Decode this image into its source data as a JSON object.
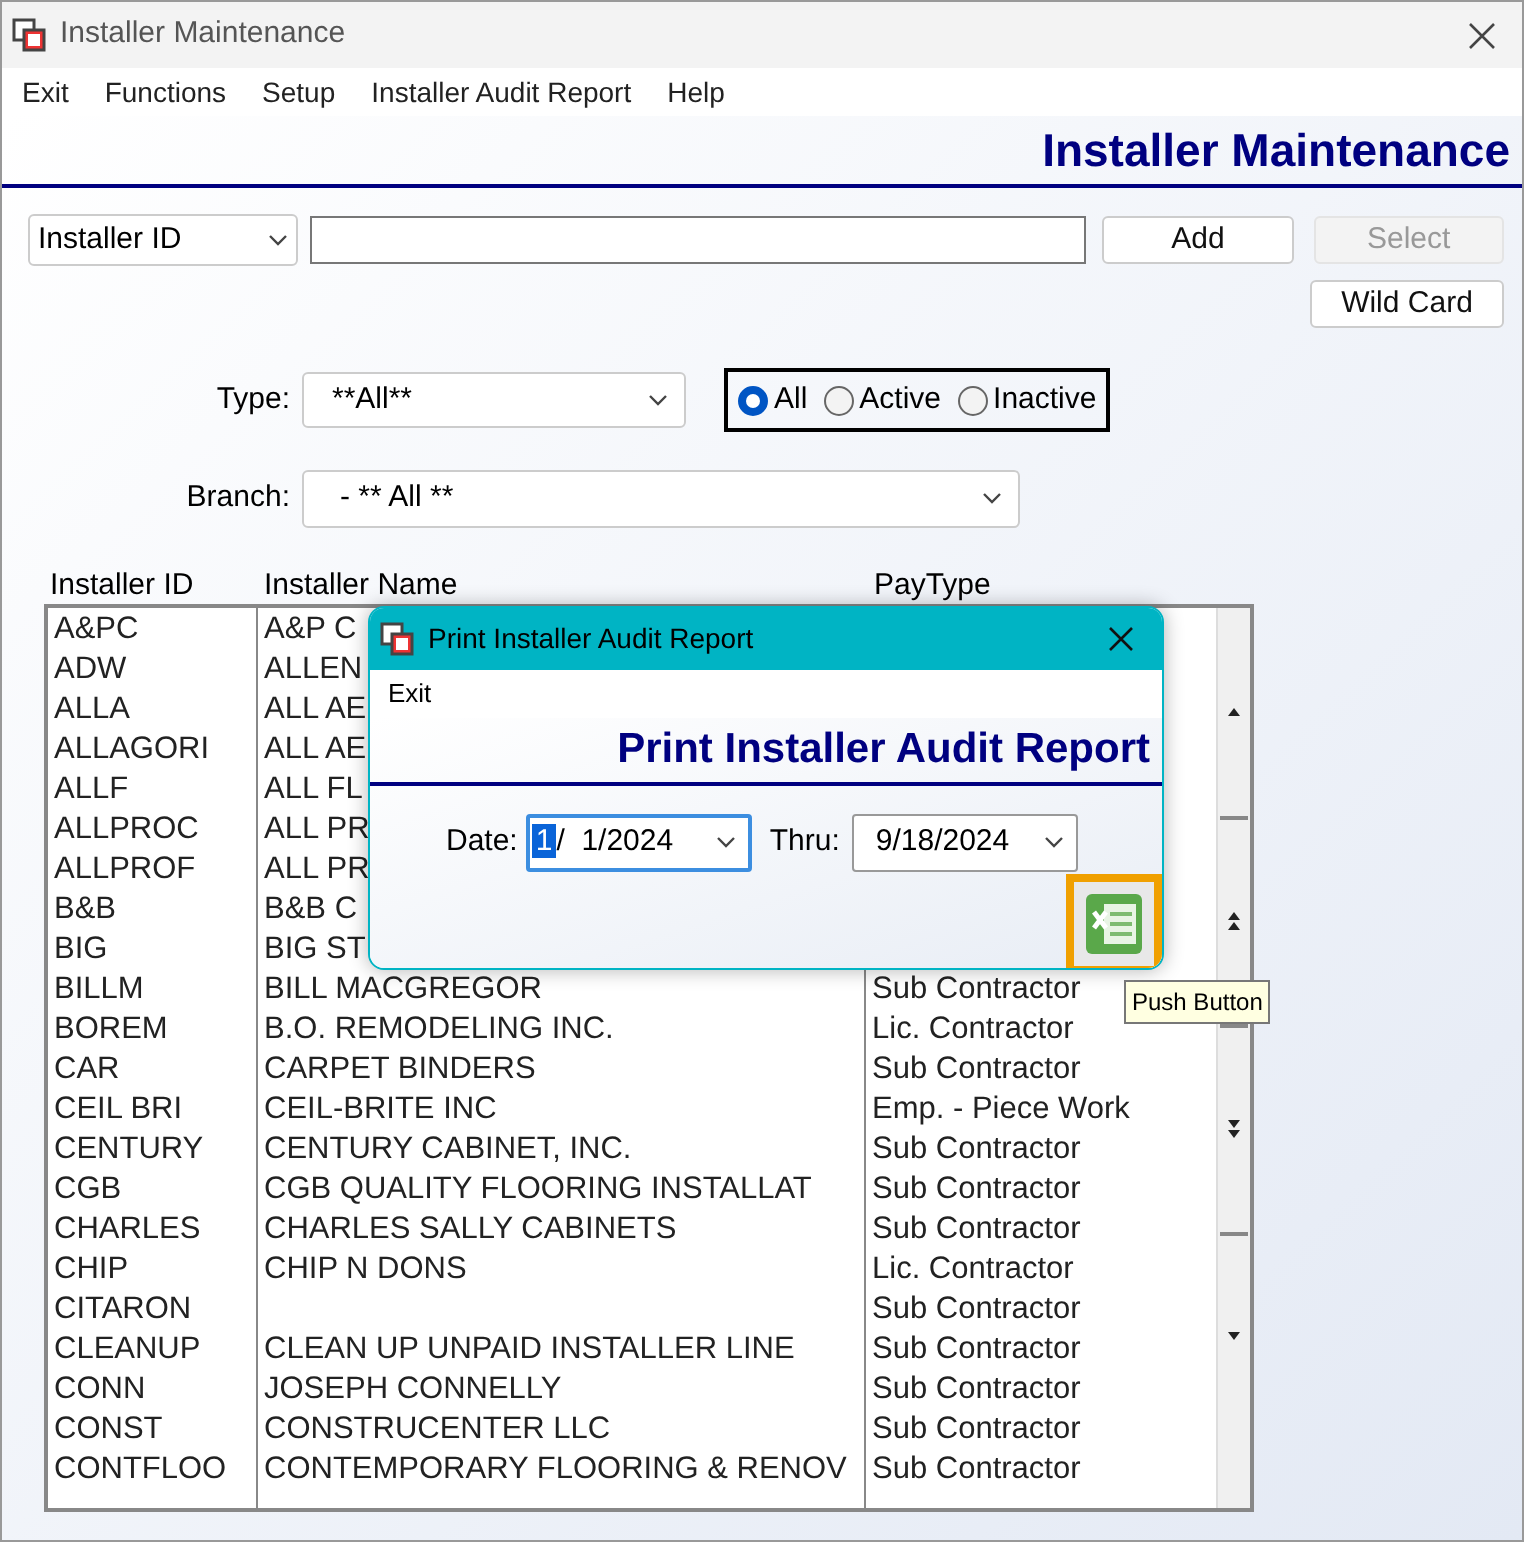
{
  "window": {
    "title": "Installer Maintenance"
  },
  "menu": [
    "Exit",
    "Functions",
    "Setup",
    "Installer Audit Report",
    "Help"
  ],
  "header": "Installer Maintenance",
  "search": {
    "field_select": "Installer ID"
  },
  "buttons": [
    {
      "label": "Add",
      "disabled": false
    },
    {
      "label": "Select",
      "disabled": true
    },
    {
      "label": "Wild Card",
      "disabled": false
    }
  ],
  "type": {
    "label": "Type:",
    "value": "**All**"
  },
  "status_options": [
    {
      "label": "All",
      "selected": true
    },
    {
      "label": "Active",
      "selected": false
    },
    {
      "label": "Inactive",
      "selected": false
    }
  ],
  "branch": {
    "label": "Branch:",
    "value": "- ** All **"
  },
  "table": {
    "columns": [
      "Installer ID",
      "Installer Name",
      "PayType"
    ],
    "rows": [
      {
        "id": "A&PC",
        "name": "A&P C"
      },
      {
        "id": "ADW",
        "name": "ALLEN"
      },
      {
        "id": "ALLA",
        "name": "ALL AE"
      },
      {
        "id": "ALLAGORI",
        "name": "ALL AE"
      },
      {
        "id": "ALLF",
        "name": "ALL FL"
      },
      {
        "id": "ALLPROC",
        "name": "ALL PR"
      },
      {
        "id": "ALLPROF",
        "name": "ALL PR"
      },
      {
        "id": "B&B",
        "name": "B&B C"
      },
      {
        "id": "BIG",
        "name": "BIG ST"
      },
      {
        "id": "BILLM",
        "name": "BILL MACGREGOR",
        "paytype": "Sub Contractor"
      },
      {
        "id": "BOREM",
        "name": "B.O. REMODELING INC.",
        "paytype": "Lic. Contractor"
      },
      {
        "id": "CAR",
        "name": "CARPET BINDERS",
        "paytype": "Sub Contractor"
      },
      {
        "id": "CEIL BRI",
        "name": "CEIL-BRITE INC",
        "paytype": "Emp. - Piece Work"
      },
      {
        "id": "CENTURY",
        "name": "CENTURY CABINET, INC.",
        "paytype": "Sub Contractor"
      },
      {
        "id": "CGB",
        "name": "CGB QUALITY FLOORING INSTALLAT",
        "paytype": "Sub Contractor"
      },
      {
        "id": "CHARLES",
        "name": "CHARLES SALLY CABINETS",
        "paytype": "Sub Contractor"
      },
      {
        "id": "CHIP",
        "name": "CHIP N DONS",
        "paytype": "Lic. Contractor"
      },
      {
        "id": "CITARON",
        "paytype": "Sub Contractor"
      },
      {
        "id": "CLEANUP",
        "name": "CLEAN UP UNPAID INSTALLER LINE",
        "paytype": "Sub Contractor"
      },
      {
        "id": "CONN",
        "name": "JOSEPH CONNELLY",
        "paytype": "Sub Contractor"
      },
      {
        "id": "CONST",
        "name": "CONSTRUCENTER LLC",
        "paytype": "Sub Contractor"
      },
      {
        "id": "CONTFLOO",
        "name": "CONTEMPORARY FLOORING & RENOV",
        "paytype": "Sub Contractor"
      }
    ]
  },
  "dialog": {
    "title": "Print Installer Audit Report",
    "menu": [
      "Exit"
    ],
    "header": "Print Installer Audit Report",
    "date": {
      "label": "Date:",
      "parts": [
        {
          "text": "1",
          "selected": true
        },
        {
          "text": "/  1/2024",
          "selected": false
        }
      ]
    },
    "thru": {
      "label": "Thru:",
      "value": "9/18/2024"
    },
    "tooltip": "Push Button"
  }
}
